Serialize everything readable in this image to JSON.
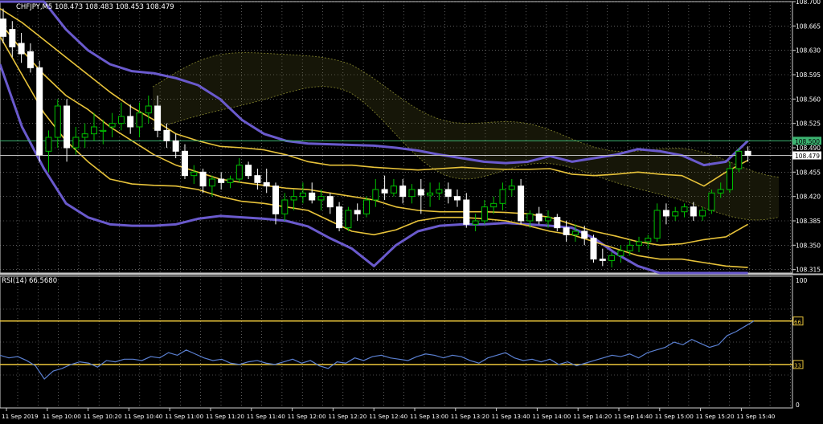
{
  "chart_data": [
    {
      "type": "candlestick",
      "title": "CHFJPY,M5  108.473 108.483 108.453 108.479",
      "y_ticks": [
        "108.700",
        "108.665",
        "108.630",
        "108.595",
        "108.560",
        "108.525",
        "108.490",
        "108.455",
        "108.420",
        "108.385",
        "108.350",
        "108.315"
      ],
      "ylim": [
        108.31,
        108.7
      ],
      "price_tags": {
        "upper": "108.500",
        "current": "108.479"
      },
      "levels": {
        "upper": 108.5,
        "current": 108.479
      },
      "grid": true,
      "colors": {
        "bull": "#000000",
        "bear": "#ffffff",
        "wick_bull": "#00c000",
        "wick_bear": "#ffffff",
        "band_purple": "#6a5acd",
        "band_gold": "#e8c33a",
        "ichimoku": "#7a7a2a",
        "grid": "#9a9a9a",
        "level": "#3cb371"
      },
      "candles": [
        [
          108.675,
          108.69,
          108.64,
          108.65
        ],
        [
          108.66,
          108.672,
          108.62,
          108.635
        ],
        [
          108.64,
          108.655,
          108.612,
          108.625
        ],
        [
          108.628,
          108.64,
          108.598,
          108.605
        ],
        [
          108.605,
          108.615,
          108.47,
          108.48
        ],
        [
          108.485,
          108.515,
          108.455,
          108.505
        ],
        [
          108.505,
          108.56,
          108.49,
          108.55
        ],
        [
          108.55,
          108.56,
          108.47,
          108.49
        ],
        [
          108.49,
          108.52,
          108.48,
          108.505
        ],
        [
          108.505,
          108.525,
          108.49,
          108.51
        ],
        [
          108.51,
          108.54,
          108.5,
          108.52
        ],
        [
          108.515,
          108.53,
          108.495,
          108.515
        ],
        [
          108.52,
          108.54,
          108.505,
          108.525
        ],
        [
          108.525,
          108.555,
          108.515,
          108.535
        ],
        [
          108.535,
          108.552,
          108.51,
          108.52
        ],
        [
          108.52,
          108.555,
          108.505,
          108.54
        ],
        [
          108.54,
          108.565,
          108.525,
          108.55
        ],
        [
          108.55,
          108.565,
          108.505,
          108.515
        ],
        [
          108.515,
          108.525,
          108.49,
          108.5
        ],
        [
          108.5,
          108.51,
          108.475,
          108.485
        ],
        [
          108.485,
          108.495,
          108.445,
          108.45
        ],
        [
          108.45,
          108.465,
          108.438,
          108.455
        ],
        [
          108.455,
          108.46,
          108.425,
          108.435
        ],
        [
          108.435,
          108.45,
          108.42,
          108.445
        ],
        [
          108.445,
          108.455,
          108.43,
          108.44
        ],
        [
          108.44,
          108.45,
          108.432,
          108.445
        ],
        [
          108.445,
          108.475,
          108.44,
          108.465
        ],
        [
          108.465,
          108.47,
          108.445,
          108.45
        ],
        [
          108.45,
          108.46,
          108.43,
          108.44
        ],
        [
          108.44,
          108.46,
          108.425,
          108.435
        ],
        [
          108.435,
          108.44,
          108.38,
          108.395
        ],
        [
          108.395,
          108.425,
          108.385,
          108.415
        ],
        [
          108.415,
          108.43,
          108.4,
          108.42
        ],
        [
          108.42,
          108.44,
          108.41,
          108.425
        ],
        [
          108.425,
          108.44,
          108.41,
          108.415
        ],
        [
          108.415,
          108.43,
          108.4,
          108.42
        ],
        [
          108.42,
          108.425,
          108.395,
          108.405
        ],
        [
          108.405,
          108.412,
          108.37,
          108.375
        ],
        [
          108.375,
          108.405,
          108.37,
          108.4
        ],
        [
          108.4,
          108.41,
          108.385,
          108.395
        ],
        [
          108.395,
          108.42,
          108.39,
          108.415
        ],
        [
          108.415,
          108.445,
          108.405,
          108.43
        ],
        [
          108.43,
          108.45,
          108.415,
          108.425
        ],
        [
          108.425,
          108.445,
          108.42,
          108.435
        ],
        [
          108.435,
          108.445,
          108.41,
          108.42
        ],
        [
          108.42,
          108.438,
          108.41,
          108.43
        ],
        [
          108.43,
          108.445,
          108.395,
          108.422
        ],
        [
          108.422,
          108.44,
          108.405,
          108.425
        ],
        [
          108.425,
          108.44,
          108.415,
          108.43
        ],
        [
          108.43,
          108.44,
          108.41,
          108.42
        ],
        [
          108.42,
          108.43,
          108.405,
          108.415
        ],
        [
          108.415,
          108.425,
          108.375,
          108.38
        ],
        [
          108.38,
          108.395,
          108.37,
          108.385
        ],
        [
          108.385,
          108.415,
          108.38,
          108.405
        ],
        [
          108.405,
          108.42,
          108.395,
          108.41
        ],
        [
          108.41,
          108.44,
          108.4,
          108.43
        ],
        [
          108.43,
          108.445,
          108.42,
          108.435
        ],
        [
          108.435,
          108.445,
          108.38,
          108.385
        ],
        [
          108.385,
          108.4,
          108.375,
          108.395
        ],
        [
          108.395,
          108.405,
          108.38,
          108.385
        ],
        [
          108.385,
          108.4,
          108.375,
          108.39
        ],
        [
          108.39,
          108.395,
          108.37,
          108.375
        ],
        [
          108.375,
          108.385,
          108.355,
          108.365
        ],
        [
          108.365,
          108.38,
          108.355,
          108.37
        ],
        [
          108.37,
          108.378,
          108.35,
          108.36
        ],
        [
          108.36,
          108.365,
          108.325,
          108.33
        ],
        [
          108.33,
          108.345,
          108.32,
          108.328
        ],
        [
          108.328,
          108.34,
          108.318,
          108.335
        ],
        [
          108.335,
          108.35,
          108.325,
          108.342
        ],
        [
          108.342,
          108.358,
          108.335,
          108.35
        ],
        [
          108.35,
          108.362,
          108.34,
          108.355
        ],
        [
          108.355,
          108.365,
          108.345,
          108.36
        ],
        [
          108.36,
          108.41,
          108.355,
          108.4
        ],
        [
          108.4,
          108.41,
          108.38,
          108.392
        ],
        [
          108.392,
          108.405,
          108.385,
          108.398
        ],
        [
          108.398,
          108.41,
          108.39,
          108.405
        ],
        [
          108.405,
          108.412,
          108.385,
          108.392
        ],
        [
          108.392,
          108.405,
          108.385,
          108.4
        ],
        [
          108.4,
          108.43,
          108.395,
          108.425
        ],
        [
          108.425,
          108.44,
          108.418,
          108.43
        ],
        [
          108.43,
          108.47,
          108.425,
          108.46
        ],
        [
          108.46,
          108.49,
          108.455,
          108.485
        ],
        [
          108.485,
          108.492,
          108.47,
          108.479
        ]
      ],
      "bands": {
        "purple_upper": [
          108.74,
          108.72,
          108.7,
          108.66,
          108.63,
          108.61,
          108.6,
          108.597,
          108.59,
          108.58,
          108.56,
          108.53,
          108.51,
          108.5,
          108.496,
          108.495,
          108.494,
          108.493,
          108.49,
          108.486,
          108.48,
          108.475,
          108.47,
          108.468,
          108.47,
          108.478,
          108.47,
          108.475,
          108.48,
          108.488,
          108.485,
          108.479,
          108.465,
          108.47,
          108.5
        ],
        "purple_lower": [
          108.61,
          108.52,
          108.46,
          108.41,
          108.39,
          108.38,
          108.378,
          108.378,
          108.38,
          108.388,
          108.392,
          108.39,
          108.388,
          108.385,
          108.377,
          108.36,
          108.345,
          108.32,
          108.35,
          108.37,
          108.378,
          108.38,
          108.38,
          108.382,
          108.38,
          108.378,
          108.375,
          108.36,
          108.338,
          108.32,
          108.29,
          108.275,
          108.27,
          108.275,
          108.28
        ],
        "gold_upper": [
          108.69,
          108.67,
          108.645,
          108.62,
          108.595,
          108.57,
          108.548,
          108.53,
          108.51,
          108.5,
          108.492,
          108.49,
          108.487,
          108.48,
          108.47,
          108.465,
          108.465,
          108.462,
          108.46,
          108.458,
          108.46,
          108.462,
          108.46,
          108.459,
          108.459,
          108.46,
          108.452,
          108.45,
          108.452,
          108.455,
          108.452,
          108.45,
          108.435,
          108.455,
          108.472
        ],
        "gold_mid": [
          108.67,
          108.63,
          108.595,
          108.565,
          108.545,
          108.52,
          108.5,
          108.48,
          108.465,
          108.455,
          108.445,
          108.44,
          108.436,
          108.432,
          108.43,
          108.425,
          108.42,
          108.415,
          108.405,
          108.4,
          108.398,
          108.398,
          108.398,
          108.397,
          108.395,
          108.39,
          108.38,
          108.37,
          108.363,
          108.355,
          108.35,
          108.352,
          108.358,
          108.362,
          108.38
        ],
        "gold_lower": [
          108.65,
          108.595,
          108.54,
          108.5,
          108.47,
          108.445,
          108.438,
          108.436,
          108.435,
          108.43,
          108.42,
          108.413,
          108.41,
          108.405,
          108.4,
          108.385,
          108.37,
          108.365,
          108.372,
          108.385,
          108.39,
          108.39,
          108.388,
          108.385,
          108.378,
          108.37,
          108.365,
          108.355,
          108.345,
          108.335,
          108.33,
          108.33,
          108.325,
          108.32,
          108.318
        ]
      }
    },
    {
      "type": "line",
      "title": "RSI(14) 66.5680",
      "ylim": [
        0,
        100
      ],
      "y_ticks": [
        "100",
        "66",
        "33",
        "0"
      ],
      "levels": [
        66,
        33
      ],
      "level_tags": [
        "66",
        "33"
      ],
      "values": [
        40,
        38,
        39,
        36,
        32,
        22,
        28,
        30,
        33,
        35,
        34,
        31,
        36,
        35,
        37,
        37,
        36,
        39,
        38,
        42,
        40,
        44,
        41,
        38,
        36,
        37,
        34,
        33,
        35,
        36,
        34,
        33,
        35,
        37,
        34,
        36,
        32,
        30,
        35,
        34,
        38,
        36,
        39,
        40,
        38,
        37,
        36,
        39,
        41,
        40,
        38,
        40,
        39,
        36,
        34,
        38,
        40,
        42,
        38,
        36,
        37,
        35,
        37,
        33,
        35,
        32,
        34,
        36,
        38,
        40,
        39,
        41,
        38,
        42,
        44,
        46,
        50,
        48,
        52,
        49,
        46,
        48,
        55,
        58,
        62,
        66
      ],
      "color": "#5a7fd0",
      "level_color": "#e8c33a"
    }
  ],
  "x_ticks": [
    "11 Sep 2019",
    "11 Sep 10:00",
    "11 Sep 10:20",
    "11 Sep 10:40",
    "11 Sep 11:00",
    "11 Sep 11:20",
    "11 Sep 11:40",
    "11 Sep 12:00",
    "11 Sep 12:20",
    "11 Sep 12:40",
    "11 Sep 13:00",
    "11 Sep 13:20",
    "11 Sep 13:40",
    "11 Sep 14:00",
    "11 Sep 14:20",
    "11 Sep 14:40",
    "11 Sep 15:00",
    "11 Sep 15:20",
    "11 Sep 15:40"
  ]
}
